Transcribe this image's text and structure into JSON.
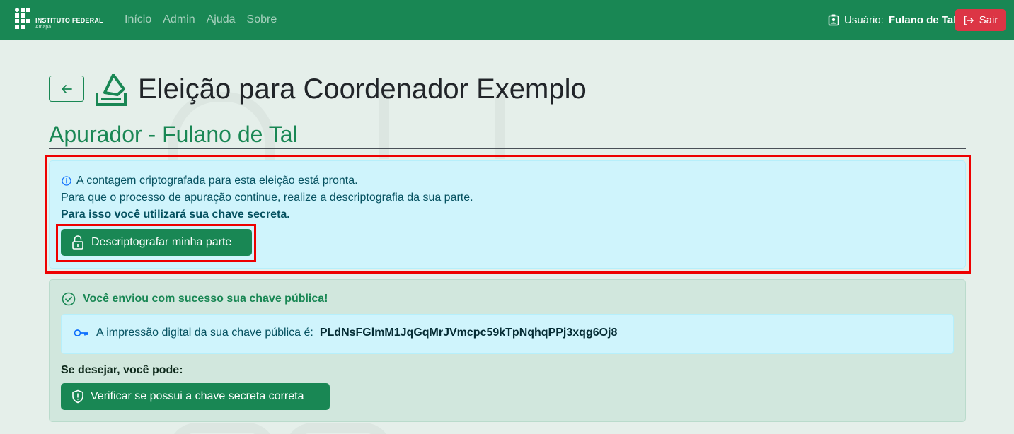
{
  "navbar": {
    "brand_title": "INSTITUTO FEDERAL",
    "brand_sub": "Amapá",
    "links": [
      "Início",
      "Admin",
      "Ajuda",
      "Sobre"
    ],
    "user_label": "Usuário:",
    "user_name": "Fulano de Tal",
    "logout_label": "Sair"
  },
  "header": {
    "title": "Eleição para Coordenador Exemplo",
    "subtitle": "Apurador - Fulano de Tal"
  },
  "info_alert": {
    "line1": "A contagem criptografada para esta eleição está pronta.",
    "line2": "Para que o processo de apuração continue, realize a descriptografia da sua parte.",
    "line3": "Para isso você utilizará sua chave secreta.",
    "button_label": "Descriptografar minha parte"
  },
  "success_alert": {
    "heading": "Você enviou com sucesso sua chave pública!",
    "fingerprint_label": "A impressão digital da sua chave pública é:",
    "fingerprint_value": "PLdNsFGlmM1JqGqMrJVmcpc59kTpNqhqPPj3xqg6Oj8",
    "options_label": "Se desejar, você pode:",
    "verify_button_label": "Verificar se possui a chave secreta correta"
  },
  "colors": {
    "primary": "#198754",
    "danger": "#dc3545",
    "info_bg": "#cff4fc",
    "success_bg": "#d1e7dd",
    "highlight": "#ee0000"
  }
}
